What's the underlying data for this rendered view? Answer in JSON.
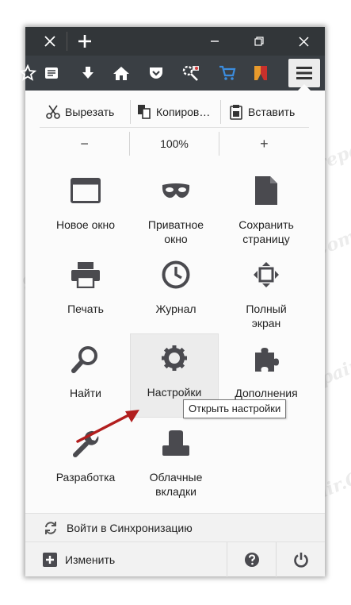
{
  "watermark_text": "Soringpcrepair.Com",
  "colors": {
    "titlebar": "#323639",
    "toolbar": "#3a3f44",
    "panel": "#fbfbfb",
    "icon_gray": "#4a4a4f",
    "arrow_red": "#b21e1e"
  },
  "titlebar": {
    "tab_close_icon": "close-icon",
    "new_tab_icon": "plus-icon",
    "minimize_icon": "minimize-icon",
    "restore_icon": "restore-icon",
    "close_icon": "close-icon"
  },
  "toolbar": {
    "tools": [
      "star-icon",
      "reading-list-icon",
      "download-icon",
      "home-icon",
      "pocket-icon",
      "tools-icon",
      "cart-icon",
      "bookmark-icon"
    ],
    "menu_icon": "hamburger-menu-icon"
  },
  "menu": {
    "edit": {
      "cut": "Вырезать",
      "copy": "Копиров…",
      "paste": "Вставить"
    },
    "zoom": {
      "minus": "−",
      "value": "100%",
      "plus": "+"
    },
    "items": [
      {
        "label": "Новое окно",
        "icon": "new-window-icon"
      },
      {
        "label": "Приватное\nокно",
        "icon": "private-mask-icon"
      },
      {
        "label": "Сохранить\nстраницу",
        "icon": "save-page-icon"
      },
      {
        "label": "Печать",
        "icon": "printer-icon"
      },
      {
        "label": "Журнал",
        "icon": "history-clock-icon"
      },
      {
        "label": "Полный\nэкран",
        "icon": "fullscreen-icon"
      },
      {
        "label": "Найти",
        "icon": "search-icon"
      },
      {
        "label": "Настройки",
        "icon": "gear-icon"
      },
      {
        "label": "Дополнения",
        "icon": "puzzle-icon"
      },
      {
        "label": "Разработка",
        "icon": "wrench-icon"
      },
      {
        "label": "Облачные\nвкладки",
        "icon": "cloud-tabs-icon"
      }
    ],
    "tooltip": "Открыть настройки",
    "sync": "Войти в Синхронизацию",
    "customize": "Изменить",
    "help_icon": "help-icon",
    "quit_icon": "power-icon"
  }
}
